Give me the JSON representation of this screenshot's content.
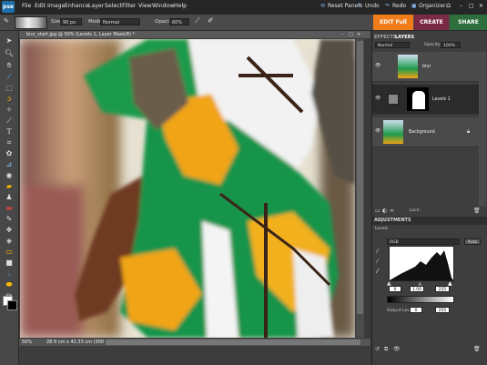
{
  "app": {
    "logo": "pse"
  },
  "menu": [
    "File",
    "Edit",
    "Image",
    "Enhance",
    "Layer",
    "Select",
    "Filter",
    "View",
    "Window",
    "Help"
  ],
  "topbar": {
    "reset_panels": "Reset Panels",
    "undo": "Undo",
    "redo": "Redo",
    "organizer": "Organizer"
  },
  "options": {
    "size_label": "Size:",
    "size_value": "90 px",
    "mode_label": "Mode:",
    "mode_value": "Normal",
    "opacity_label": "Opacity:",
    "opacity_value": "60%"
  },
  "modes": {
    "edit_full": "EDIT Full",
    "create": "CREATE",
    "share": "SHARE"
  },
  "document": {
    "tab_title": "blur_start.jpg @ 50% (Levels 1, Layer Mask/8) *",
    "zoom": "50%",
    "doc_size": "28.9 cm x 42.33 cm (300 ppi)"
  },
  "panels": {
    "tabs": [
      "EFFECTS",
      "LAYERS"
    ],
    "blend_mode": "Normal",
    "opacity_label": "Opacity:",
    "opacity_value": "100%",
    "layers": [
      {
        "name": "blur"
      },
      {
        "name": "Levels 1"
      },
      {
        "name": "Background"
      }
    ],
    "lock_label": "Lock:",
    "adjustments_title": "ADJUSTMENTS",
    "adjustment_name": "Levels",
    "channel": "RGB",
    "auto_label": "Auto",
    "input_values": [
      "0",
      "1.00",
      "255"
    ],
    "output_label": "Output Levels:",
    "output_values": [
      "0",
      "255"
    ]
  },
  "colors": {
    "edit_full": "#f07d1a",
    "create": "#7a2a46",
    "share": "#2d6e3c",
    "foreground": "#000000",
    "background": "#ffffff"
  }
}
